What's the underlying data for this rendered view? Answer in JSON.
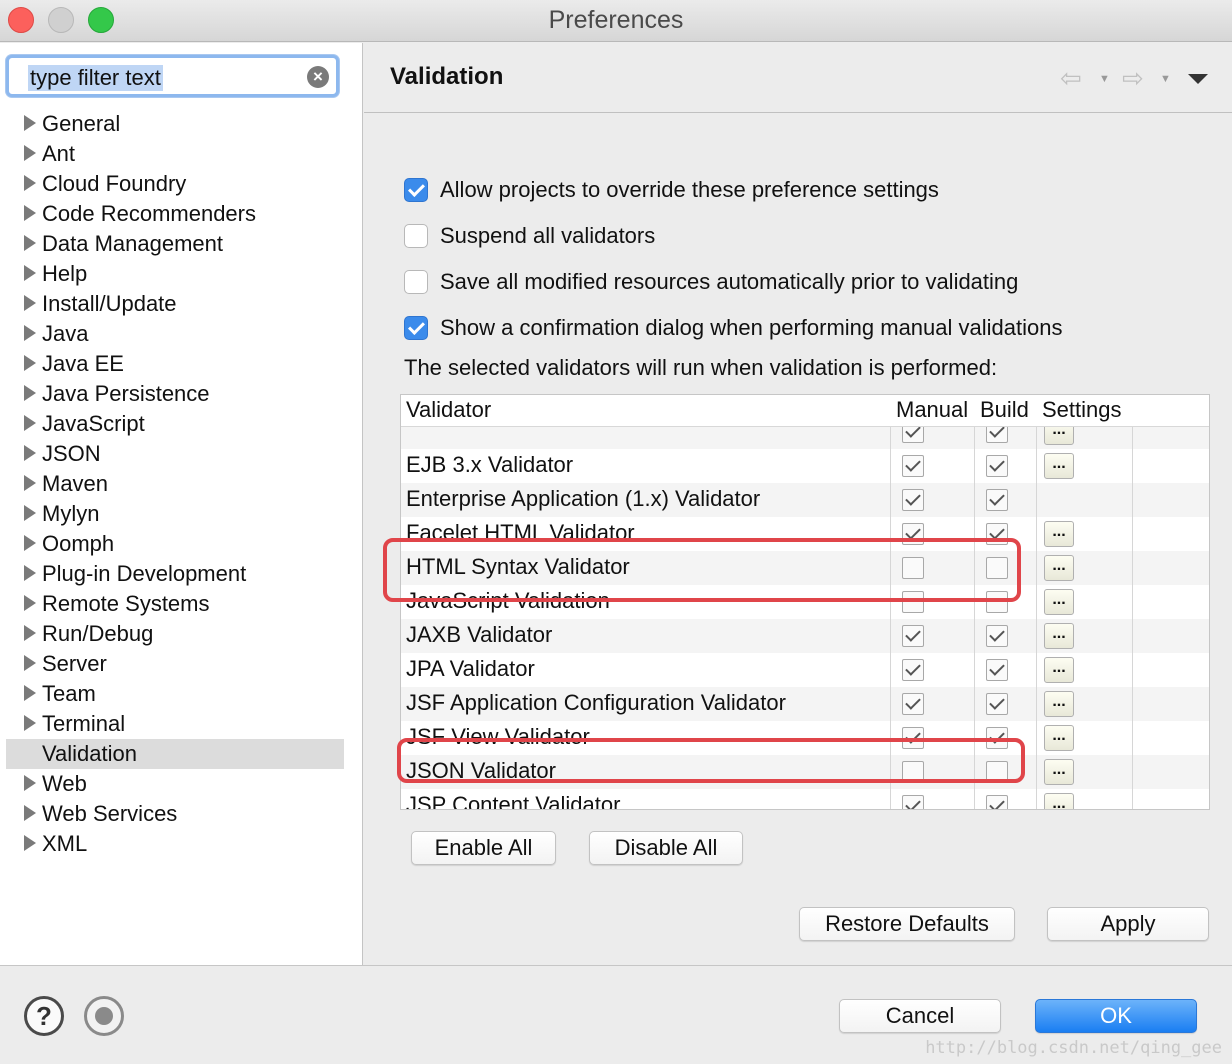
{
  "window": {
    "title": "Preferences"
  },
  "filter": {
    "placeholder": "type filter text"
  },
  "tree": [
    {
      "label": "General",
      "expandable": true
    },
    {
      "label": "Ant",
      "expandable": true
    },
    {
      "label": "Cloud Foundry",
      "expandable": true
    },
    {
      "label": "Code Recommenders",
      "expandable": true
    },
    {
      "label": "Data Management",
      "expandable": true
    },
    {
      "label": "Help",
      "expandable": true
    },
    {
      "label": "Install/Update",
      "expandable": true
    },
    {
      "label": "Java",
      "expandable": true
    },
    {
      "label": "Java EE",
      "expandable": true
    },
    {
      "label": "Java Persistence",
      "expandable": true
    },
    {
      "label": "JavaScript",
      "expandable": true
    },
    {
      "label": "JSON",
      "expandable": true
    },
    {
      "label": "Maven",
      "expandable": true
    },
    {
      "label": "Mylyn",
      "expandable": true
    },
    {
      "label": "Oomph",
      "expandable": true
    },
    {
      "label": "Plug-in Development",
      "expandable": true
    },
    {
      "label": "Remote Systems",
      "expandable": true
    },
    {
      "label": "Run/Debug",
      "expandable": true
    },
    {
      "label": "Server",
      "expandable": true
    },
    {
      "label": "Team",
      "expandable": true
    },
    {
      "label": "Terminal",
      "expandable": true
    },
    {
      "label": "Validation",
      "expandable": false,
      "selected": true
    },
    {
      "label": "Web",
      "expandable": true
    },
    {
      "label": "Web Services",
      "expandable": true
    },
    {
      "label": "XML",
      "expandable": true
    }
  ],
  "page": {
    "title": "Validation"
  },
  "options": [
    {
      "label": "Allow projects to override these preference settings",
      "checked": true
    },
    {
      "label": "Suspend all validators",
      "checked": false
    },
    {
      "label": "Save all modified resources automatically prior to validating",
      "checked": false
    },
    {
      "label": "Show a confirmation dialog when performing manual validations",
      "checked": true
    }
  ],
  "description": "The selected validators will run when validation is performed:",
  "table": {
    "headers": {
      "validator": "Validator",
      "manual": "Manual",
      "build": "Build",
      "settings": "Settings"
    },
    "settings_label": "...",
    "rows": [
      {
        "name": "",
        "manual": true,
        "build": true,
        "settings": true
      },
      {
        "name": "EJB 3.x Validator",
        "manual": true,
        "build": true,
        "settings": true
      },
      {
        "name": "Enterprise Application (1.x) Validator",
        "manual": true,
        "build": true,
        "settings": false
      },
      {
        "name": "Facelet HTML Validator",
        "manual": true,
        "build": true,
        "settings": true
      },
      {
        "name": "HTML Syntax Validator",
        "manual": false,
        "build": false,
        "settings": true
      },
      {
        "name": "JavaScript Validation",
        "manual": false,
        "build": false,
        "settings": true
      },
      {
        "name": "JAXB Validator",
        "manual": true,
        "build": true,
        "settings": true
      },
      {
        "name": "JPA Validator",
        "manual": true,
        "build": true,
        "settings": true
      },
      {
        "name": "JSF Application Configuration Validator",
        "manual": true,
        "build": true,
        "settings": true
      },
      {
        "name": "JSF View Validator",
        "manual": true,
        "build": true,
        "settings": true
      },
      {
        "name": "JSON Validator",
        "manual": false,
        "build": false,
        "settings": true
      },
      {
        "name": "JSP Content Validator",
        "manual": true,
        "build": true,
        "settings": true
      }
    ]
  },
  "buttons": {
    "enable_all": "Enable All",
    "disable_all": "Disable All",
    "restore_defaults": "Restore Defaults",
    "apply": "Apply",
    "cancel": "Cancel",
    "ok": "OK"
  },
  "footer": {
    "help": "?"
  },
  "watermark": "http://blog.csdn.net/qing_gee",
  "colors": {
    "accent": "#3b8beb",
    "highlight": "#e0454a",
    "ok_button": "#1a7ef2"
  }
}
